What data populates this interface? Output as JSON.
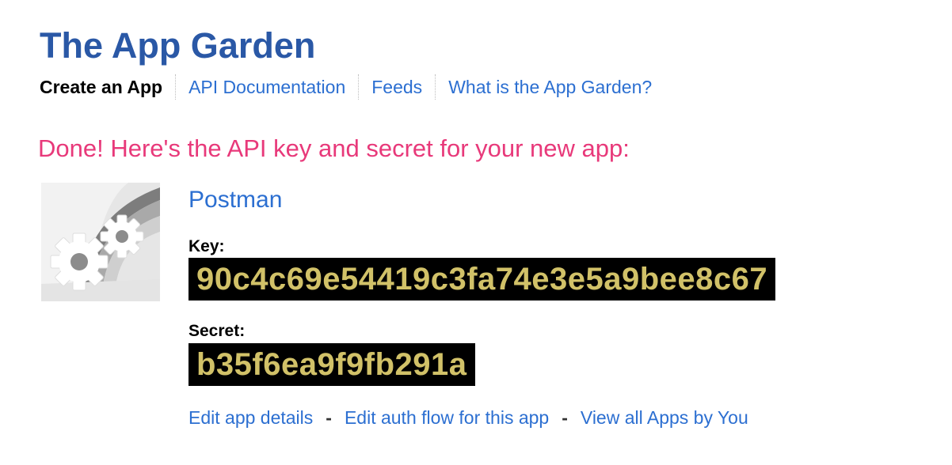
{
  "site": {
    "title": "The App Garden"
  },
  "nav": {
    "items": [
      {
        "label": "Create an App",
        "active": true
      },
      {
        "label": "API Documentation",
        "active": false
      },
      {
        "label": "Feeds",
        "active": false
      },
      {
        "label": "What is the App Garden?",
        "active": false
      }
    ]
  },
  "result": {
    "heading": "Done! Here's the API key and secret for your new app:",
    "app": {
      "name": "Postman",
      "icon": "default-app-gear-icon"
    },
    "key_label": "Key:",
    "key_value": "90c4c69e54419c3fa74e3e5a9bee8c67",
    "secret_label": "Secret:",
    "secret_value": "b35f6ea9f9fb291a"
  },
  "actions": {
    "edit_details": "Edit app details",
    "separator": "-",
    "edit_auth": "Edit auth flow for this app",
    "view_all": "View all Apps by You"
  },
  "colors": {
    "title": "#2a58a6",
    "link": "#2c6fd1",
    "heading_pink": "#e8397a",
    "credential_text": "#d1c168",
    "credential_bg": "#000000",
    "nav_active": "#000000"
  }
}
